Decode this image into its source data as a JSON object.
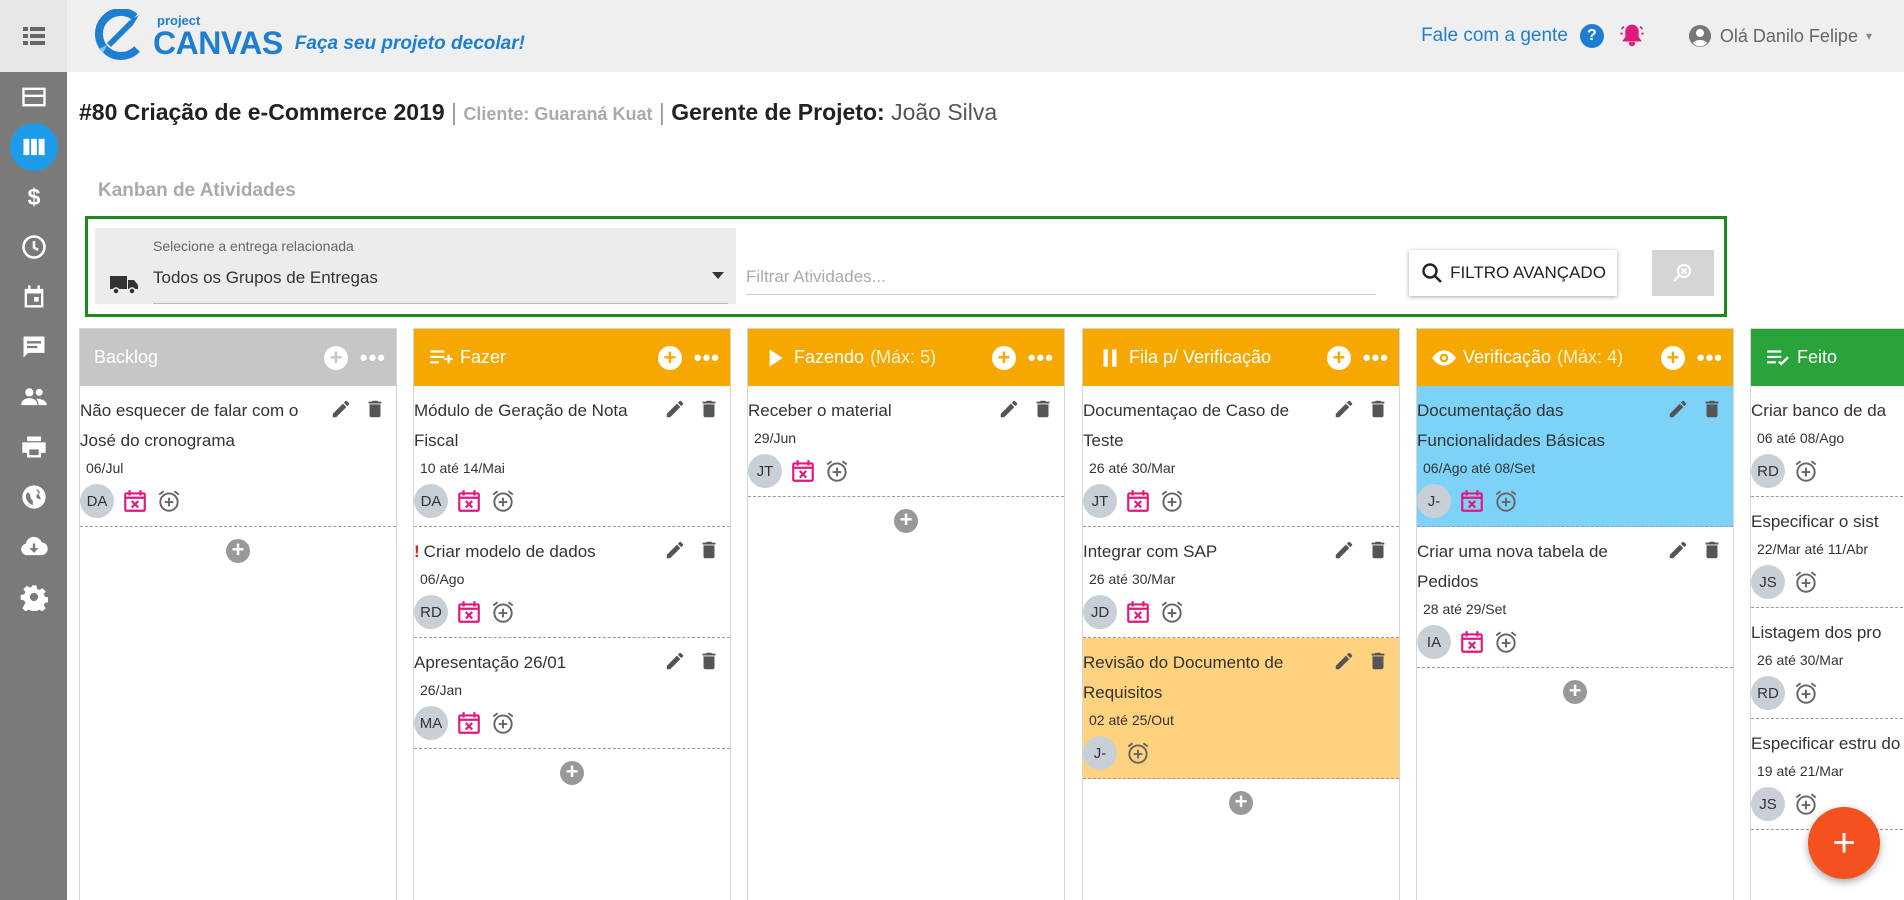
{
  "header": {
    "logo_small": "project",
    "logo_big": "CANVAS",
    "tagline": "Faça seu projeto decolar!",
    "contact": "Fale com a gente",
    "help_symbol": "?",
    "user_greeting": "Olá Danilo Felipe",
    "caret": "▾"
  },
  "sidebar": {
    "items": [
      {
        "icon": "dashboard-icon"
      },
      {
        "icon": "kanban-board-icon",
        "active": true
      },
      {
        "icon": "dollar-icon"
      },
      {
        "icon": "clock-icon"
      },
      {
        "icon": "calendar-icon"
      },
      {
        "icon": "chat-icon"
      },
      {
        "icon": "people-icon"
      },
      {
        "icon": "print-icon"
      },
      {
        "icon": "globe-icon"
      },
      {
        "icon": "cloud-download-icon"
      },
      {
        "icon": "gear-icon"
      }
    ]
  },
  "project": {
    "title": "#80 Criação de e-Commerce 2019",
    "separator": "|",
    "client": "Cliente: Guaraná Kuat",
    "manager_label": "Gerente de Projeto:",
    "manager": "João Silva"
  },
  "section_title": "Kanban de Atividades",
  "filter": {
    "delivery_label": "Selecione a entrega relacionada",
    "delivery_value": "Todos os Grupos de Entregas",
    "search_placeholder": "Filtrar Atividades...",
    "advanced_label": "FILTRO AVANÇADO"
  },
  "colors": {
    "backlog": "#c6c6c6",
    "orange": "#f6a800",
    "blue_header": "#f6a800",
    "green": "#2aa33a",
    "card_blue": "#7dd3f7",
    "card_orange": "#ffd27f",
    "brand": "#1e7fd1",
    "accent_pink": "#e0197d"
  },
  "columns": [
    {
      "key": "backlog",
      "title": "Backlog",
      "limit": "",
      "cards": [
        {
          "title": "Não esquecer de falar com o José do cronograma",
          "dates": "06/Jul",
          "avatar": "DA",
          "calendar": true
        }
      ]
    },
    {
      "key": "fazer",
      "title": "Fazer",
      "limit": "",
      "cards": [
        {
          "title": "Módulo de Geração de Nota Fiscal",
          "dates": "10 até 14/Mai",
          "avatar": "DA",
          "calendar": true
        },
        {
          "title": "Criar modelo de dados",
          "warn": "!",
          "dates": "06/Ago",
          "avatar": "RD",
          "calendar": true
        },
        {
          "title": "Apresentação 26/01",
          "dates": "26/Jan",
          "avatar": "MA",
          "calendar": true
        }
      ]
    },
    {
      "key": "fazendo",
      "title": "Fazendo",
      "limit": "(Máx: 5)",
      "cards": [
        {
          "title": "Receber o material",
          "dates": "29/Jun",
          "avatar": "JT",
          "calendar": true
        }
      ]
    },
    {
      "key": "fila",
      "title": "Fila p/ Verificação",
      "limit": "",
      "cards": [
        {
          "title": "Documentaçao de Caso de Teste",
          "dates": "26 até 30/Mar",
          "avatar": "JT",
          "calendar": true
        },
        {
          "title": "Integrar com SAP",
          "dates": "26 até 30/Mar",
          "avatar": "JD",
          "calendar": true
        },
        {
          "title": "Revisão do Documento de Requisitos",
          "dates": "02 até 25/Out",
          "avatar": "J-",
          "calendar": false,
          "highlight": "orange"
        }
      ]
    },
    {
      "key": "verificacao",
      "title": "Verificação",
      "limit": "(Máx: 4)",
      "cards": [
        {
          "title": "Documentação das Funcionalidades Básicas",
          "dates": "06/Ago até 08/Set",
          "avatar": "J-",
          "calendar": true,
          "highlight": "blue"
        },
        {
          "title": "Criar uma nova tabela de Pedidos",
          "dates": "28 até 29/Set",
          "avatar": "IA",
          "calendar": true
        }
      ]
    },
    {
      "key": "feito",
      "title": "Feito",
      "limit": "",
      "cards": [
        {
          "title": "Criar banco de da",
          "dates": "06 até 08/Ago",
          "avatar": "RD",
          "calendar": false
        },
        {
          "title": "Especificar o sist",
          "dates": "22/Mar até 11/Abr",
          "avatar": "JS",
          "calendar": false
        },
        {
          "title": "Listagem dos pro",
          "dates": "26 até 30/Mar",
          "avatar": "RD",
          "calendar": false
        },
        {
          "title": "Especificar estru do sistema",
          "dates": "19 até 21/Mar",
          "avatar": "JS",
          "calendar": false
        }
      ]
    }
  ],
  "fab_label": "+",
  "add_symbol": "+"
}
